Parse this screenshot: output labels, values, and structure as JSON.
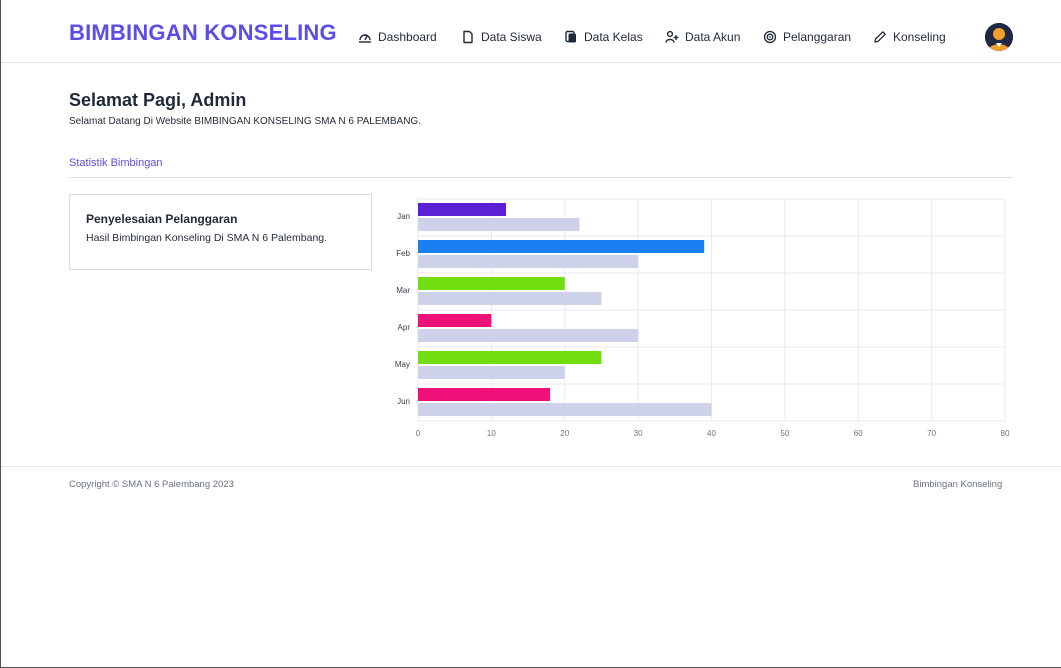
{
  "navbar": {
    "brand": "BIMBINGAN KONSELING",
    "items": [
      {
        "label": "Dashboard",
        "icon": "dashboard-icon"
      },
      {
        "label": "Data Siswa",
        "icon": "file-icon"
      },
      {
        "label": "Data Kelas",
        "icon": "copy-icon"
      },
      {
        "label": "Data Akun",
        "icon": "user-plus-icon"
      },
      {
        "label": "Pelanggaran",
        "icon": "target-icon"
      },
      {
        "label": "Konseling",
        "icon": "pencil-icon"
      }
    ]
  },
  "page": {
    "greeting": "Selamat Pagi, Admin",
    "welcome": "Selamat Datang Di Website BIMBINGAN KONSELING SMA N 6 PALEMBANG.",
    "section_title": "Statistik Bimbingan"
  },
  "card": {
    "title": "Penyelesaian Pelanggaran",
    "subtitle": "Hasil Bimbingan Konseling Di SMA N 6 Palembang."
  },
  "chart_data": {
    "type": "bar",
    "orientation": "horizontal",
    "categories": [
      "Jan",
      "Feb",
      "Mar",
      "Apr",
      "May",
      "Jun"
    ],
    "series": [
      {
        "values": [
          12,
          39,
          20,
          10,
          25,
          18
        ],
        "colors": [
          "#5b1fd6",
          "#1a7ff0",
          "#72dd10",
          "#f0107a",
          "#72dd10",
          "#f0107a"
        ]
      },
      {
        "values": [
          22,
          30,
          25,
          30,
          20,
          40
        ],
        "color": "#cdd2ea"
      }
    ],
    "xlim": [
      0,
      80
    ],
    "xticks": [
      0,
      10,
      20,
      30,
      40,
      50,
      60,
      70,
      80
    ],
    "grid": true
  },
  "footer": {
    "copyright": "Copyright © SMA N 6 Palembang 2023",
    "right": "Bimbingan Konseling"
  }
}
